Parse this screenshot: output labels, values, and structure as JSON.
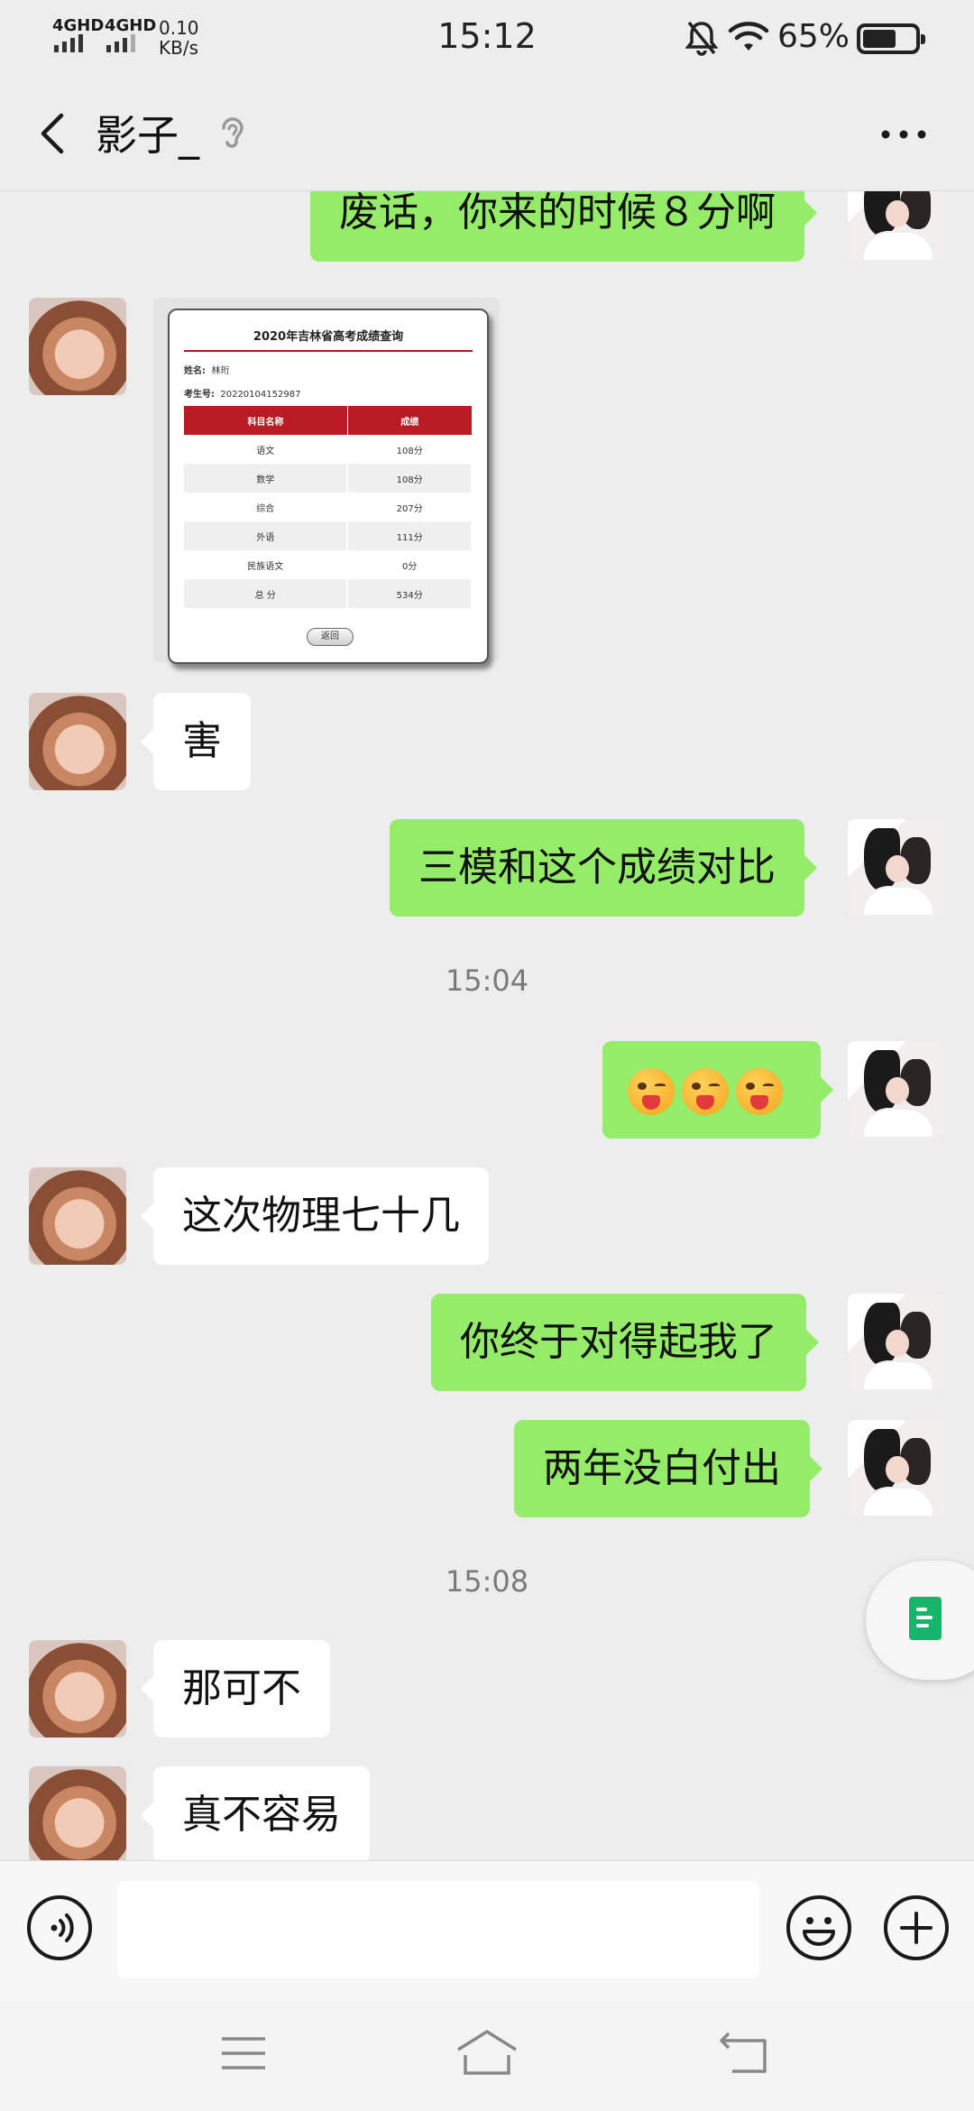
{
  "status_bar": {
    "network1": "4GHD",
    "network2": "4GHD",
    "speed_value": "0.10",
    "speed_unit": "KB/s",
    "time": "15:12",
    "battery": "65%",
    "battery_level": 0.65
  },
  "header": {
    "title": "影子_",
    "back_icon": "chevron-left-icon",
    "ear_icon": "ear-icon",
    "more_icon": "more-icon"
  },
  "messages": {
    "m1": "废话，你来的时候８分啊",
    "m2_image": {
      "title": "2020年吉林省高考成绩查询",
      "name_label": "姓名:",
      "name_value": "林珩",
      "id_label": "考生号:",
      "id_value": "20220104152987",
      "col_subject": "科目名称",
      "col_score": "成绩",
      "rows": [
        {
          "subject": "语文",
          "score": "108分"
        },
        {
          "subject": "数学",
          "score": "108分"
        },
        {
          "subject": "综合",
          "score": "207分"
        },
        {
          "subject": "外语",
          "score": "111分"
        },
        {
          "subject": "民族语文",
          "score": "0分"
        },
        {
          "subject": "总 分",
          "score": "534分"
        }
      ],
      "back_button": "返回"
    },
    "m3": "害",
    "m4": "三模和这个成绩对比",
    "ts1": "15:04",
    "m5_emoji": "winking-face-with-tongue",
    "m6": "这次物理七十几",
    "m7": "你终于对得起我了",
    "m8": "两年没白付出",
    "ts2": "15:08",
    "m9": "那可不",
    "m10": "真不容易"
  },
  "input_bar": {
    "placeholder": "",
    "voice_icon": "voice-icon",
    "emoji_icon": "emoji-icon",
    "plus_icon": "plus-icon"
  },
  "colors": {
    "sent_bubble": "#95ec69",
    "received_bubble": "#ffffff",
    "background": "#ededed"
  }
}
